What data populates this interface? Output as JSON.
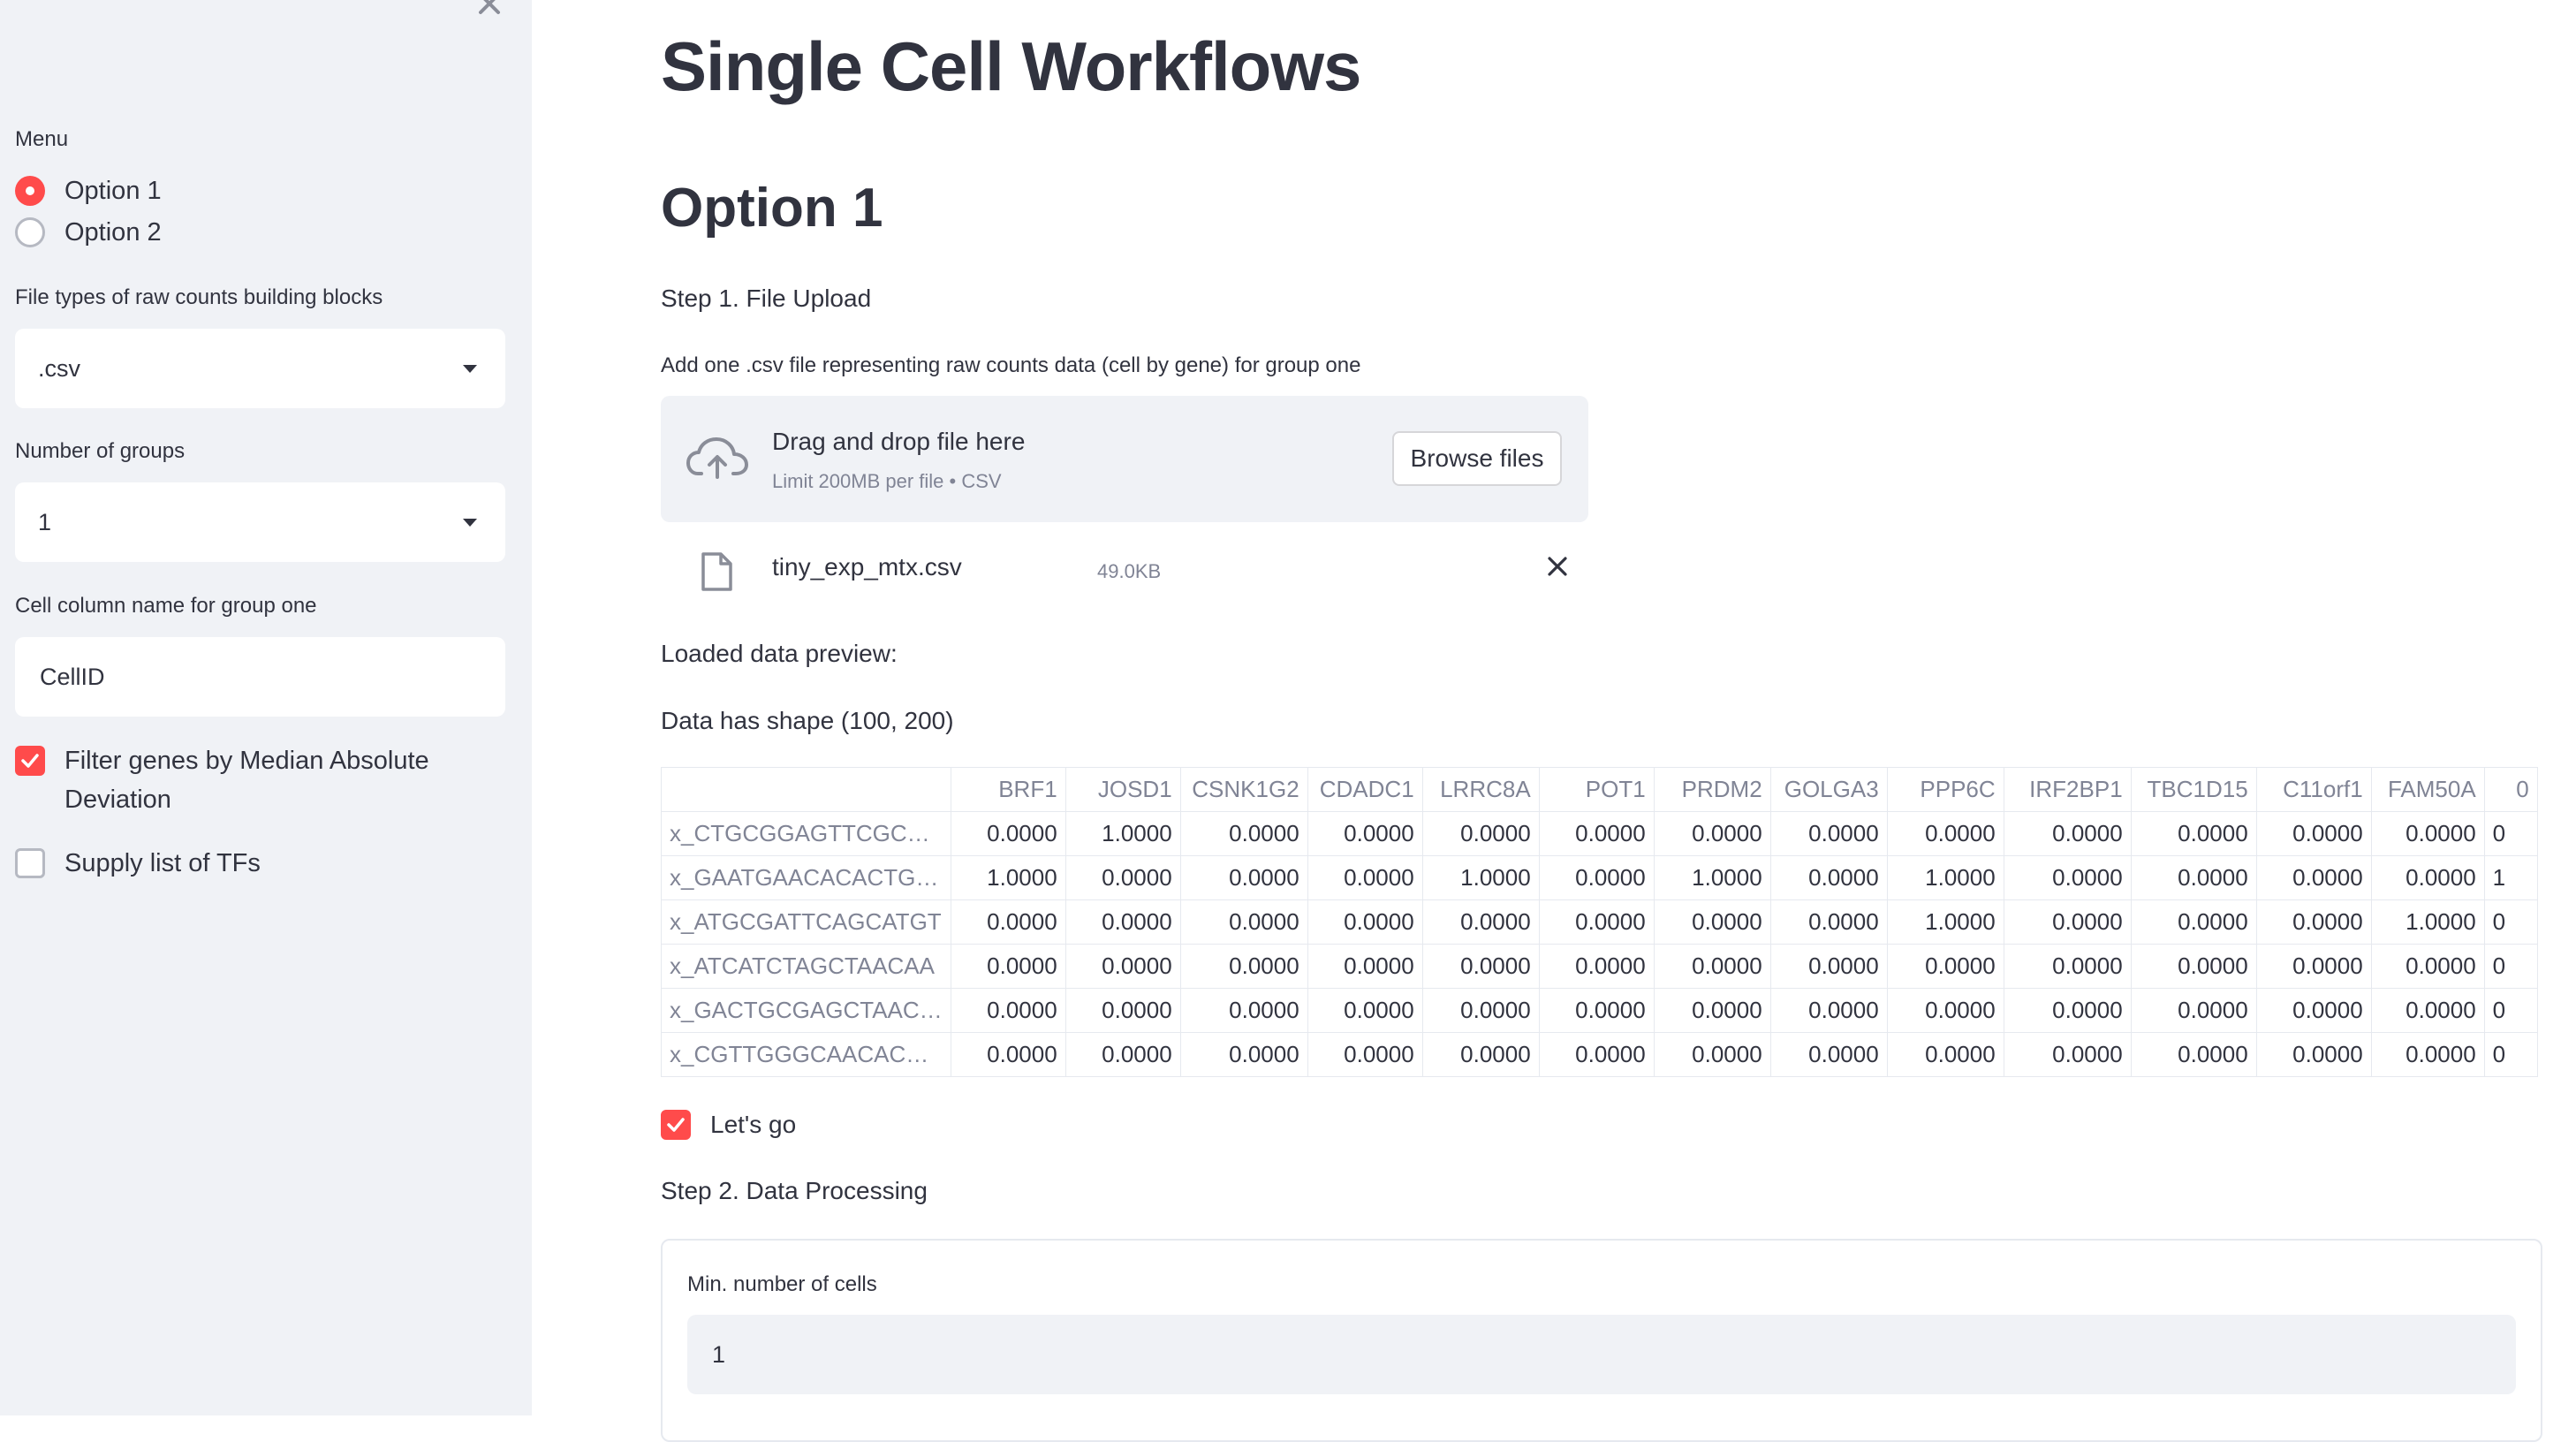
{
  "sidebar": {
    "menu_label": "Menu",
    "menu_options": [
      {
        "label": "Option 1",
        "selected": true
      },
      {
        "label": "Option 2",
        "selected": false
      }
    ],
    "file_types_label": "File types of raw counts building blocks",
    "file_types_value": ".csv",
    "num_groups_label": "Number of groups",
    "num_groups_value": "1",
    "cell_column_label": "Cell column name for group one",
    "cell_column_value": "CellID",
    "filter_mad": {
      "label": "Filter genes by Median Absolute Deviation",
      "checked": true
    },
    "supply_tfs": {
      "label": "Supply list of TFs",
      "checked": false
    }
  },
  "main": {
    "title": "Single Cell Workflows",
    "section_title": "Option 1",
    "step1": "Step 1. File Upload",
    "upload_label": "Add one .csv file representing raw counts data (cell by gene) for group one",
    "dropzone": {
      "main_text": "Drag and drop file here",
      "sub_text": "Limit 200MB per file • CSV",
      "browse_label": "Browse files"
    },
    "uploaded_file": {
      "name": "tiny_exp_mtx.csv",
      "size": "49.0KB"
    },
    "loaded_preview": "Loaded data preview:",
    "shape_text": "Data has shape (100, 200)",
    "lets_go": {
      "label": "Let's go",
      "checked": true
    },
    "step2": "Step 2. Data Processing",
    "min_cells_label": "Min. number of cells",
    "min_cells_value": "1"
  },
  "table": {
    "columns": [
      "BRF1",
      "JOSD1",
      "CSNK1G2",
      "CDADC1",
      "LRRC8A",
      "POT1",
      "PRDM2",
      "GOLGA3",
      "PPP6C",
      "IRF2BP1",
      "TBC1D15",
      "C11orf1",
      "FAM50A",
      "0"
    ],
    "rows": [
      {
        "index": "x_CTGCGGAGTTCGC…",
        "values": [
          "0.0000",
          "1.0000",
          "0.0000",
          "0.0000",
          "0.0000",
          "0.0000",
          "0.0000",
          "0.0000",
          "0.0000",
          "0.0000",
          "0.0000",
          "0.0000",
          "0.0000",
          "0"
        ]
      },
      {
        "index": "x_GAATGAACACACTG…",
        "values": [
          "1.0000",
          "0.0000",
          "0.0000",
          "0.0000",
          "1.0000",
          "0.0000",
          "1.0000",
          "0.0000",
          "1.0000",
          "0.0000",
          "0.0000",
          "0.0000",
          "0.0000",
          "1"
        ]
      },
      {
        "index": "x_ATGCGATTCAGCATGT",
        "values": [
          "0.0000",
          "0.0000",
          "0.0000",
          "0.0000",
          "0.0000",
          "0.0000",
          "0.0000",
          "0.0000",
          "1.0000",
          "0.0000",
          "0.0000",
          "0.0000",
          "1.0000",
          "0"
        ]
      },
      {
        "index": "x_ATCATCTAGCTAACAA",
        "values": [
          "0.0000",
          "0.0000",
          "0.0000",
          "0.0000",
          "0.0000",
          "0.0000",
          "0.0000",
          "0.0000",
          "0.0000",
          "0.0000",
          "0.0000",
          "0.0000",
          "0.0000",
          "0"
        ]
      },
      {
        "index": "x_GACTGCGAGCTAAC…",
        "values": [
          "0.0000",
          "0.0000",
          "0.0000",
          "0.0000",
          "0.0000",
          "0.0000",
          "0.0000",
          "0.0000",
          "0.0000",
          "0.0000",
          "0.0000",
          "0.0000",
          "0.0000",
          "0"
        ]
      },
      {
        "index": "x_CGTTGGGCAACAC…",
        "values": [
          "0.0000",
          "0.0000",
          "0.0000",
          "0.0000",
          "0.0000",
          "0.0000",
          "0.0000",
          "0.0000",
          "0.0000",
          "0.0000",
          "0.0000",
          "0.0000",
          "0.0000",
          "0"
        ]
      }
    ]
  },
  "colors": {
    "accent": "#ff4b4b",
    "sidebar_bg": "#f0f2f6",
    "text": "#31333f",
    "muted": "#808495"
  },
  "icons": {
    "close": "close-icon",
    "upload": "cloud-upload-icon",
    "file": "file-icon",
    "remove": "x-icon",
    "caret": "chevron-down-icon",
    "check": "check-icon"
  }
}
